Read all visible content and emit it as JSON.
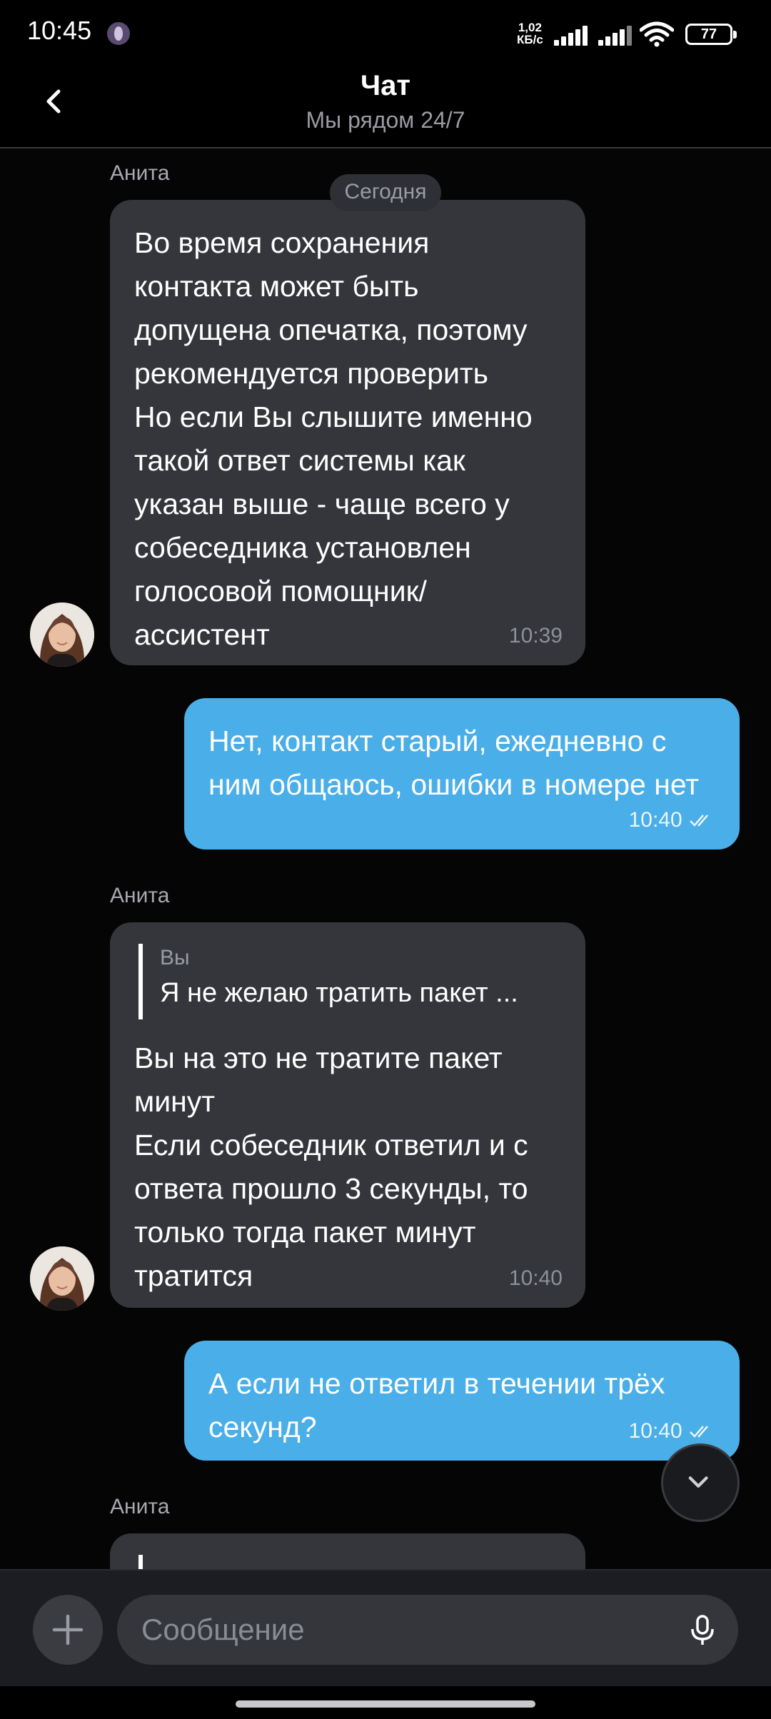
{
  "status_bar": {
    "time": "10:45",
    "net_speed_value": "1,02",
    "net_speed_unit": "КБ/с",
    "battery": "77"
  },
  "header": {
    "title": "Чат",
    "subtitle": "Мы рядом 24/7"
  },
  "chat": {
    "date_chip": "Сегодня",
    "messages": [
      {
        "sender": "Анита",
        "text": "Во время сохранения\nконтакта может быть\nдопущена опечатка, поэтому\nрекомендуется проверить\nНо если Вы слышите именно\nтакой ответ системы как\nуказан выше - чаще всего у\nсобеседника установлен\nголосовой помощник/\nассистент",
        "time": "10:39"
      },
      {
        "text": "Нет, контакт старый, ежедневно с\nним общаюсь, ошибки в номере нет",
        "time": "10:40"
      },
      {
        "sender": "Анита",
        "quote_author": "Вы",
        "quote_text": "Я не желаю тратить пакет ...",
        "text": "Вы на это не тратите пакет\nминут\nЕсли собеседник ответил и с\nответа прошло 3 секунды, то\nтолько тогда пакет минут\nтратится",
        "time": "10:40"
      },
      {
        "text": "А если не ответил в течении трёх\nсекунд?",
        "time": "10:40"
      },
      {
        "sender": "Анита"
      }
    ]
  },
  "input": {
    "placeholder": "Сообщение"
  },
  "colors": {
    "incoming_bubble": "#34363c",
    "outgoing_bubble": "#4aaee8",
    "background": "#050505"
  },
  "icons": [
    "back-icon",
    "plus-icon",
    "mic-icon",
    "chevron-down-icon",
    "double-check-icon",
    "wifi-icon",
    "signal-icon",
    "battery-icon"
  ]
}
